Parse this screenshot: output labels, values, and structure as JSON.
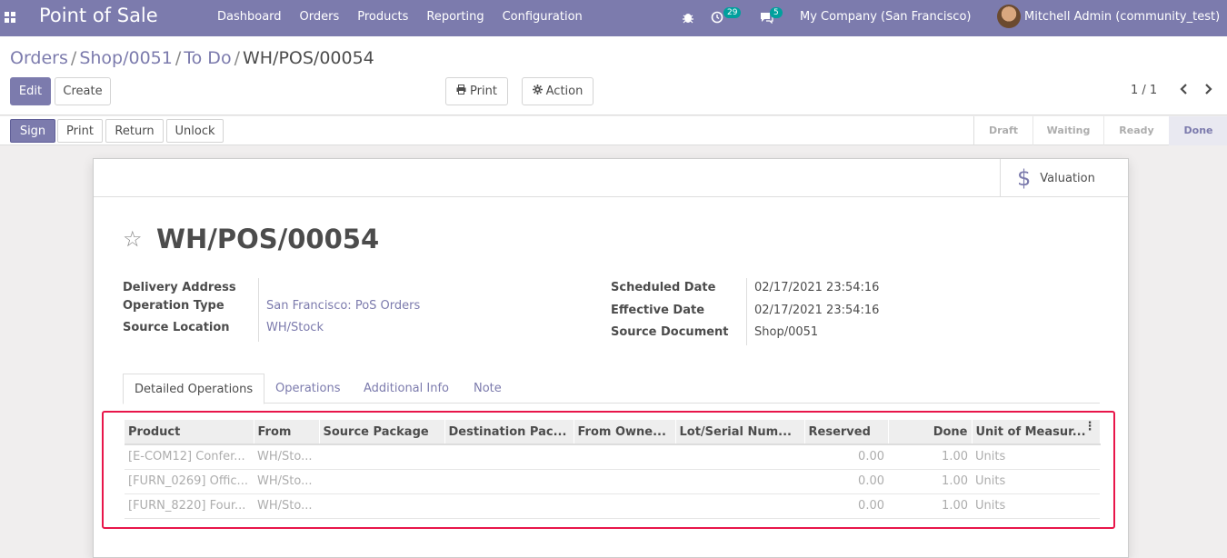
{
  "navbar": {
    "app_title": "Point of Sale",
    "menu": [
      "Dashboard",
      "Orders",
      "Products",
      "Reporting",
      "Configuration"
    ],
    "activity_count": "29",
    "message_count": "5",
    "company": "My Company (San Francisco)",
    "user": "Mitchell Admin (community_test)"
  },
  "breadcrumb": {
    "items": [
      "Orders",
      "Shop/0051",
      "To Do"
    ],
    "current": "WH/POS/00054"
  },
  "control": {
    "edit": "Edit",
    "create": "Create",
    "print": "Print",
    "action": "Action",
    "pager": "1 / 1"
  },
  "statusbar": {
    "buttons": [
      "Sign",
      "Print",
      "Return",
      "Unlock"
    ],
    "stages": [
      "Draft",
      "Waiting",
      "Ready",
      "Done"
    ],
    "active_stage": "Done"
  },
  "sheet": {
    "valuation": "Valuation",
    "title": "WH/POS/00054",
    "left_fields": [
      {
        "label": "Delivery Address",
        "value": ""
      },
      {
        "label": "Operation Type",
        "value": "San Francisco: PoS Orders"
      },
      {
        "label": "Source Location",
        "value": "WH/Stock"
      }
    ],
    "right_fields": [
      {
        "label": "Scheduled Date",
        "value": "02/17/2021 23:54:16"
      },
      {
        "label": "Effective Date",
        "value": "02/17/2021 23:54:16"
      },
      {
        "label": "Source Document",
        "value": "Shop/0051"
      }
    ],
    "tabs": [
      "Detailed Operations",
      "Operations",
      "Additional Info",
      "Note"
    ],
    "table": {
      "headers": [
        "Product",
        "From",
        "Source Package",
        "Destination Pac...",
        "From Owne...",
        "Lot/Serial Num...",
        "Reserved",
        "Done",
        "Unit of Measur..."
      ],
      "rows": [
        [
          "[E-COM12] Confer...",
          "WH/Sto...",
          "",
          "",
          "",
          "",
          "0.00",
          "1.00",
          "Units"
        ],
        [
          "[FURN_0269] Offic...",
          "WH/Sto...",
          "",
          "",
          "",
          "",
          "0.00",
          "1.00",
          "Units"
        ],
        [
          "[FURN_8220] Four...",
          "WH/Sto...",
          "",
          "",
          "",
          "",
          "0.00",
          "1.00",
          "Units"
        ]
      ]
    }
  },
  "colors": {
    "brand": "#7c7bad",
    "highlight": "#e8164a",
    "badge": "#00a09d"
  }
}
